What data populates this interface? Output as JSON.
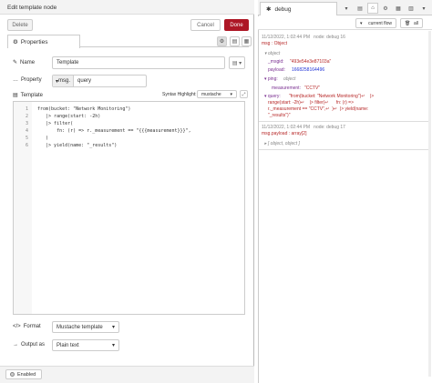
{
  "header": {
    "title": "Edit template node",
    "delete": "Delete",
    "cancel": "Cancel",
    "done": "Done"
  },
  "props": {
    "tab": "Properties"
  },
  "fields": {
    "name_label": "Name",
    "name_value": "Template",
    "property_label": "Property",
    "property_prefix": "msg.",
    "property_value": "query",
    "template_label": "Template",
    "syntax_label": "Syntax Highlight:",
    "syntax_value": "mustache",
    "format_label": "Format",
    "format_value": "Mustache template",
    "output_label": "Output as",
    "output_value": "Plain text"
  },
  "editor": {
    "lines": [
      {
        "n": "1",
        "t": "from(bucket: \"Network Monitoring\")"
      },
      {
        "n": "2",
        "t": "   |> range(start: -2h)"
      },
      {
        "n": "3",
        "t": "   |> filter("
      },
      {
        "n": "4",
        "t": "       fn: (r) => r._measurement == \"{{{measurement}}}\","
      },
      {
        "n": "5",
        "t": "   )"
      },
      {
        "n": "6",
        "t": "   |> yield(name: \"_results\")"
      }
    ]
  },
  "footer": {
    "enabled": "Enabled"
  },
  "debug": {
    "tab": "debug",
    "filter": "current flow",
    "all": "all",
    "msg1": {
      "meta": "11/12/2022, 1:02:44 PM   node: debug 16",
      "sub": "msg : Object",
      "obj": "▾ object",
      "msgid_k": "_msgid:",
      "msgid_v": "\"493e54e3e87103a\"",
      "payload_k": "payload:",
      "payload_v": "1668258164496",
      "ping_k": "▾ ping:",
      "ping_v": "object",
      "meas_k": "measurement:",
      "meas_v": "\"CCTV\"",
      "query_k": "▾ query:",
      "query_v1": "\"from(bucket: \"Network Monitoring\")↵    |>",
      "query_v2": "range(start: -2h)↵    |> filter(↵      fn: (r) =>",
      "query_v3": "r._measurement == \"CCTV\",↵  )↵  |> yield(name:",
      "query_v4": "\"_results\")\""
    },
    "msg2": {
      "meta": "11/12/2022, 1:02:44 PM   node: debug 17",
      "sub": "msg.payload : array[2]",
      "val": "▸ [ object, object ]"
    }
  }
}
